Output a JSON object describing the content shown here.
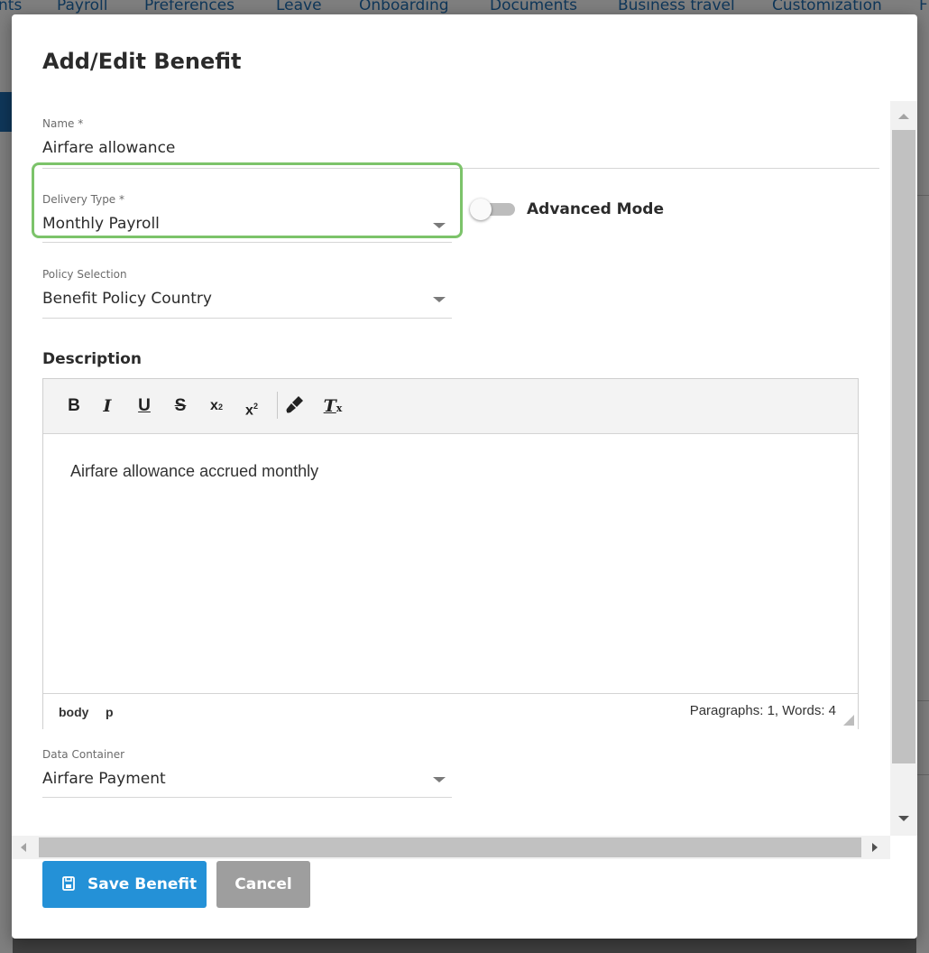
{
  "background_nav": {
    "items": [
      "nts",
      "Payroll",
      "Preferences",
      "Leave",
      "Onboarding",
      "Documents",
      "Business travel",
      "Customization",
      "F"
    ]
  },
  "dialog": {
    "title": "Add/Edit Benefit",
    "name_field": {
      "label": "Name *",
      "value": "Airfare allowance"
    },
    "delivery_type": {
      "label": "Delivery Type *",
      "value": "Monthly Payroll"
    },
    "advanced_mode": {
      "label": "Advanced Mode",
      "enabled": false
    },
    "policy_selection": {
      "label": "Policy Selection",
      "value": "Benefit Policy Country"
    },
    "description": {
      "label": "Description",
      "toolbar": [
        "bold",
        "italic",
        "underline",
        "strikethrough",
        "subscript",
        "superscript",
        "format-painter",
        "clear-formatting"
      ],
      "content": "Airfare allowance accrued monthly",
      "path": [
        "body",
        "p"
      ],
      "word_count": "Paragraphs: 1, Words: 4"
    },
    "data_container": {
      "label": "Data Container",
      "value": "Airfare Payment"
    },
    "buttons": {
      "save": "Save Benefit",
      "cancel": "Cancel"
    }
  },
  "colors": {
    "highlight_border": "#7cc36a",
    "save_button": "#2491d7",
    "cancel_button": "#9e9e9e",
    "nav_link": "#1f6fb5"
  }
}
